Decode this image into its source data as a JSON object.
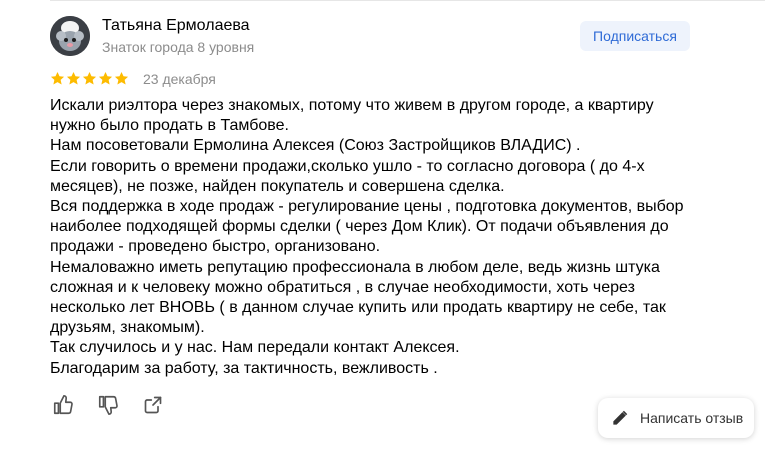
{
  "author": {
    "name": "Татьяна Ермолаева",
    "level": "Знаток города 8 уровня"
  },
  "subscribe_label": "Подписаться",
  "review": {
    "rating": 5,
    "max_rating": 5,
    "date": "23 декабря",
    "lines": [
      "Искали риэлтора через знакомых, потому что живем в другом городе, а квартиру",
      "нужно было продать в Тамбове.",
      "Нам посоветовали Ермолина Алексея (Союз Застройщиков ВЛАДИС) .",
      "Если говорить о времени продажи,сколько ушло - то согласно договора ( до 4-х",
      "месяцев), не позже, найден покупатель и совершена сделка.",
      "Вся поддержка в ходе продаж - регулирование цены , подготовка документов, выбор",
      "наиболее подходящей формы сделки ( через Дом Клик). От подачи объявления до",
      "продажи - проведено быстро, организовано.",
      "Немаловажно иметь репутацию профессионала в любом деле, ведь жизнь штука",
      "сложная и к человеку можно обратиться , в случае необходимости, хоть через",
      "несколько лет ВНОВЬ ( в данном случае купить или продать квартиру не себе, так",
      "друзьям, знакомым).",
      "Так случилось и у нас. Нам передали контакт Алексея.",
      "Благодарим за работу, за тактичность, вежливость ."
    ]
  },
  "actions": {
    "like_icon": "thumbs-up-icon",
    "dislike_icon": "thumbs-down-icon",
    "share_icon": "share-icon"
  },
  "write_review_label": "Написать отзыв",
  "colors": {
    "star": "#fdbb00",
    "subscribe_text": "#2f6bd6",
    "subscribe_bg": "#eef3fc",
    "secondary_text": "#8c8c8c"
  }
}
